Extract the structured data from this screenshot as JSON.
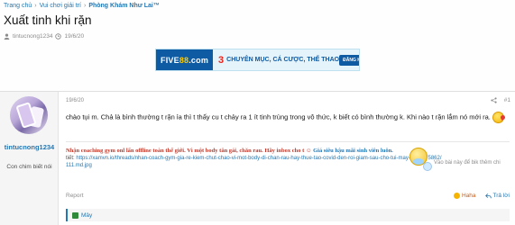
{
  "breadcrumb": {
    "items": [
      "Trang chủ",
      "Vui chơi giải trí",
      "Phòng Khám Như Lai™"
    ],
    "separator": "›"
  },
  "thread": {
    "title": "Xuất tinh khi rặn",
    "author": "tintucnong1234",
    "date": "19/6/20"
  },
  "banner": {
    "logo_a": "FIVE",
    "logo_b": "88",
    "logo_c": ".com",
    "promo_num": "3",
    "promo_text": "CHUYÊN MỤC, CÁ CƯỢC, THỂ THAO",
    "cta": "ĐĂNG KÝ NGAY"
  },
  "post": {
    "username": "tintucnong1234",
    "user_title": "Con chim biết nói",
    "date": "19/6/20",
    "number": "#1",
    "body": "chào tụi m. Chả là bình thường t rặn ỉa thì t thấy cu t chảy ra 1 ít tinh trùng trong vô thức, k biết có bình thường k. Khi nào t rặn lắm nó mới ra.",
    "signature_line1": "Nhận coaching gym onl lấn offline toàn thế giới. Vì một body tân gái, chăn rau. Hãy inbox cho t",
    "signature_line1_b": "Giá siêu hậu mãi sinh viên luôn.",
    "signature_note": "Vào bài này để bik thêm chi",
    "signature_label": "tiết:",
    "signature_link": "https://xamvn.io/threads/nhan-coach-gym-gia-re-kiem-chut-chao-vi-mot-body-di-chan-rau-hay-thue-tao-covid-den-roi-giam-sau-cho-tui-may-luon.275862/",
    "signature_link2": "111.md.jpg",
    "report": "Report",
    "reaction": "Haha",
    "reply": "Trả lời",
    "reactions_by": "Mây"
  },
  "colors": {
    "link": "#2577b1",
    "muted": "#8c8c8c",
    "signature_red": "#c0392b"
  }
}
